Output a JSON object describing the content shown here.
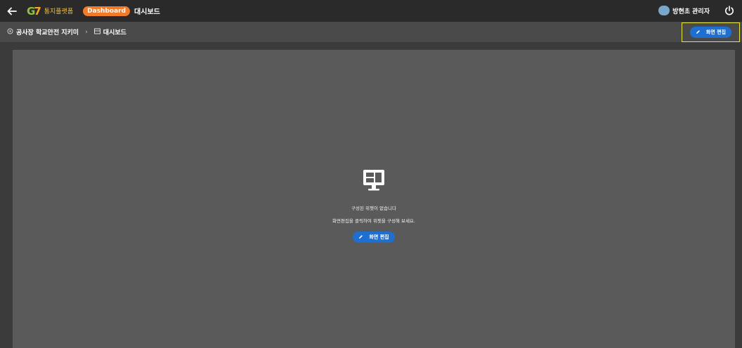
{
  "topbar": {
    "logo_text": "통지플랫폼",
    "badge": "Dashboard",
    "title": "대시보드",
    "user_name": "방현초 관리자"
  },
  "breadcrumb": {
    "project": "공사장 학교안전 지키미",
    "page": "대시보드"
  },
  "toolbar": {
    "edit_label": "화면 편집"
  },
  "empty_state": {
    "title": "구성된 위젯이 없습니다",
    "description": "화면편집을 클릭하여 위젯을 구성해 보세요.",
    "button_label": "화면 편집"
  },
  "colors": {
    "accent": "#1f6fd1",
    "badge": "#f07b2a",
    "highlight": "#e5e53a"
  }
}
